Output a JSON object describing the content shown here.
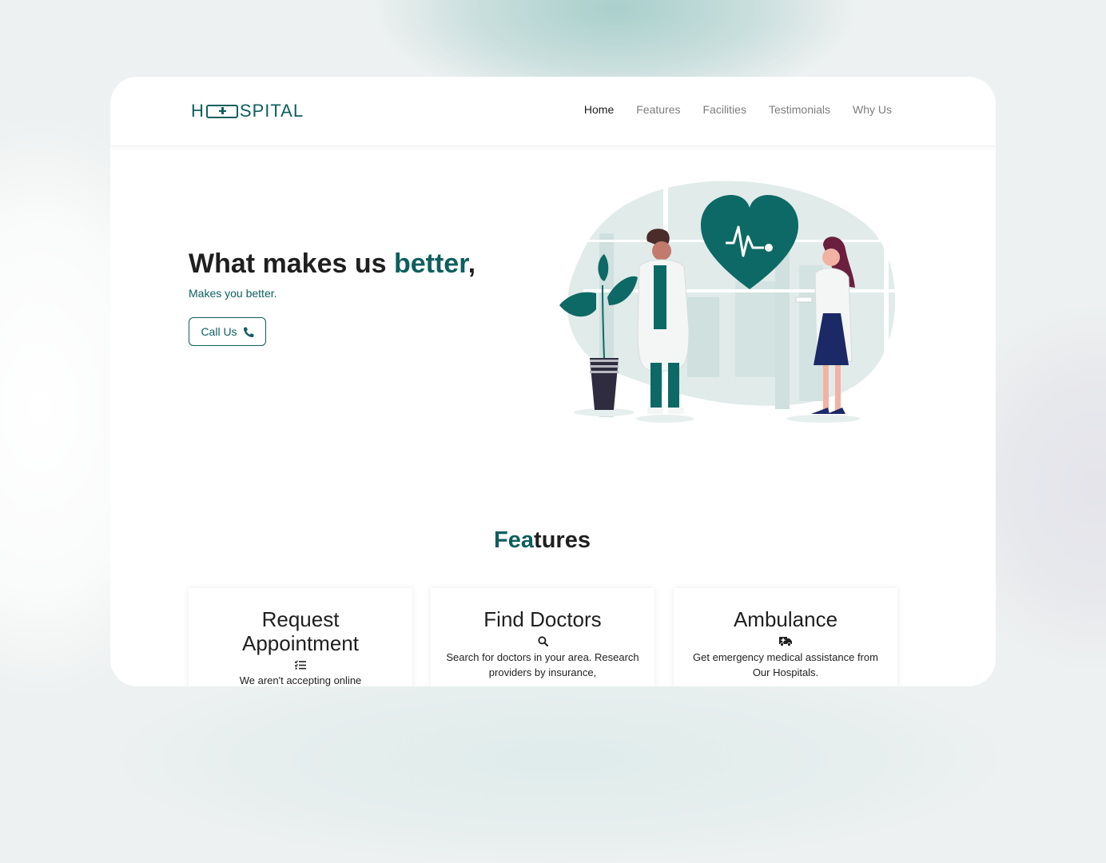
{
  "brand": {
    "logo_prefix": "H",
    "logo_suffix": "SPITAL",
    "color": "#0d5f5d"
  },
  "nav": {
    "items": [
      {
        "label": "Home",
        "active": true
      },
      {
        "label": "Features",
        "active": false
      },
      {
        "label": "Facilities",
        "active": false
      },
      {
        "label": "Testimonials",
        "active": false
      },
      {
        "label": "Why Us",
        "active": false
      }
    ]
  },
  "hero": {
    "title_main": "What makes us ",
    "title_accent": "better",
    "title_end": ",",
    "subtitle": "Makes you better.",
    "cta_label": "Call Us",
    "cta_icon": "phone-icon"
  },
  "features": {
    "title_accent": "Fea",
    "title_rest": "tures",
    "cards": [
      {
        "title": "Request Appointment",
        "icon": "list-check-icon",
        "text": "We aren't accepting online"
      },
      {
        "title": "Find Doctors",
        "icon": "search-icon",
        "text": "Search for doctors in your area. Research providers by insurance,"
      },
      {
        "title": "Ambulance",
        "icon": "ambulance-icon",
        "text": "Get emergency medical assistance from Our Hospitals."
      }
    ]
  }
}
